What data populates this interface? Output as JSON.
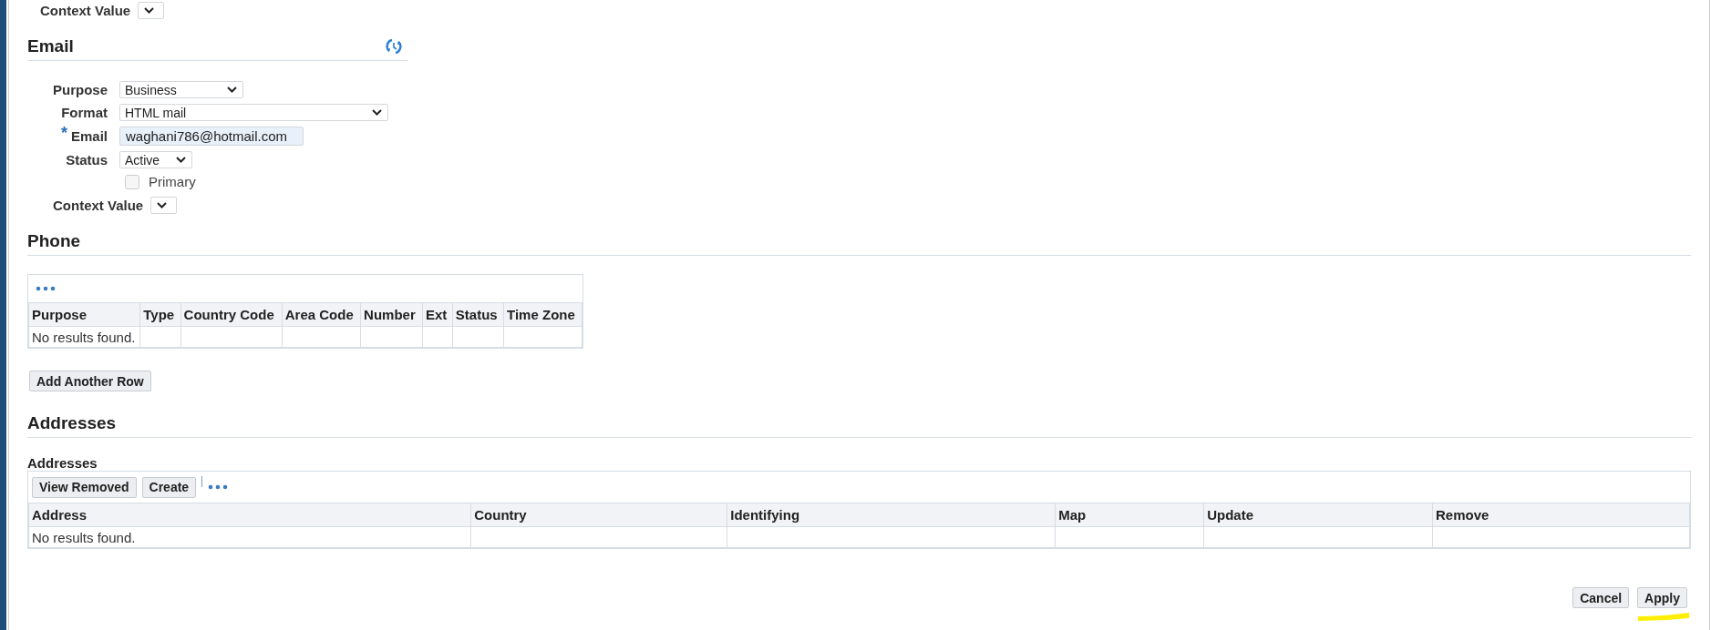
{
  "top_context": {
    "label": "Context Value"
  },
  "email": {
    "title": "Email",
    "fields": [
      {
        "kind": "select",
        "label": "Purpose",
        "value": "Business"
      },
      {
        "kind": "select",
        "label": "Format",
        "value": "HTML mail"
      },
      {
        "kind": "text",
        "label": "Email",
        "value": "waghani786@hotmail.com",
        "required_mark": "*"
      },
      {
        "kind": "select",
        "label": "Status",
        "value": "Active"
      },
      {
        "kind": "checkbox",
        "label": "Primary",
        "checked": false
      },
      {
        "kind": "select",
        "label": "Context Value"
      }
    ]
  },
  "phone": {
    "title": "Phone",
    "table": {
      "columns": [
        "Purpose",
        "Type",
        "Country Code",
        "Area Code",
        "Number",
        "Ext",
        "Status",
        "Time Zone"
      ],
      "empty_text": "No results found."
    },
    "button": "Add Another Row"
  },
  "addresses": {
    "title": "Addresses",
    "subtitle": "Addresses",
    "buttons": [
      "View Removed",
      "Create"
    ],
    "table": {
      "columns": [
        "Address",
        "Country",
        "Identifying",
        "Map",
        "Update",
        "Remove"
      ],
      "empty_text": "No results found."
    }
  },
  "footer_buttons": [
    "Cancel",
    "Apply"
  ]
}
